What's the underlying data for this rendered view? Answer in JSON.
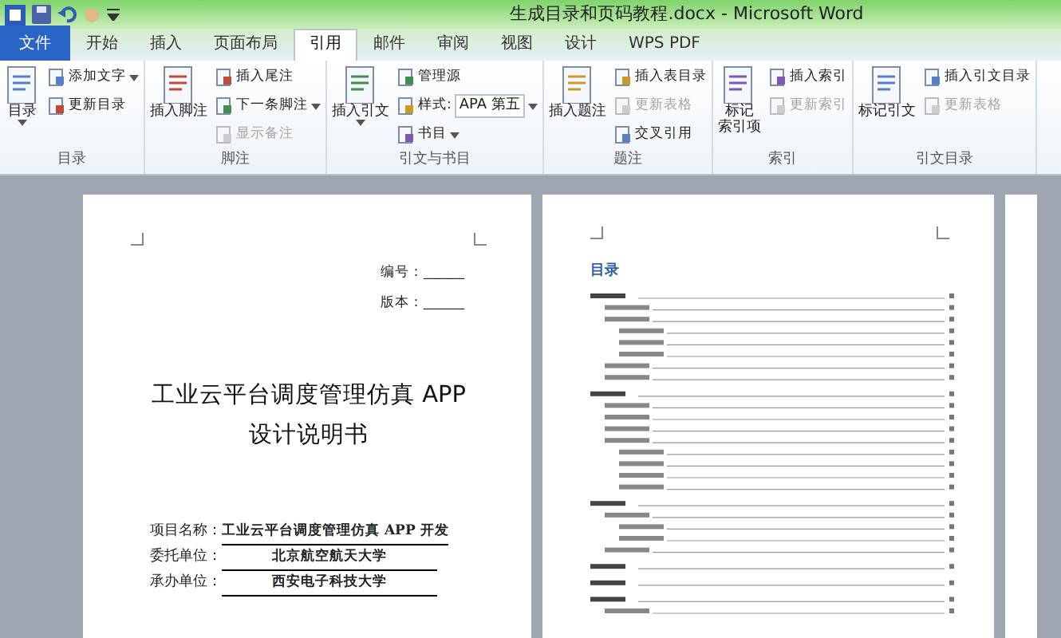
{
  "window": {
    "title": "生成目录和页码教程.docx - Microsoft Word"
  },
  "tabs": [
    {
      "label": "文件",
      "kind": "file",
      "selected": false
    },
    {
      "label": "开始",
      "kind": "tab",
      "selected": false
    },
    {
      "label": "插入",
      "kind": "tab",
      "selected": false
    },
    {
      "label": "页面布局",
      "kind": "tab",
      "selected": false
    },
    {
      "label": "引用",
      "kind": "tab",
      "selected": true
    },
    {
      "label": "邮件",
      "kind": "tab",
      "selected": false
    },
    {
      "label": "审阅",
      "kind": "tab",
      "selected": false
    },
    {
      "label": "视图",
      "kind": "tab",
      "selected": false
    },
    {
      "label": "设计",
      "kind": "tab",
      "selected": false
    },
    {
      "label": "WPS PDF",
      "kind": "tab",
      "selected": false
    }
  ],
  "ribbon_groups": [
    {
      "label": "目录",
      "large": [
        {
          "label": "目录",
          "dropdown": true
        }
      ],
      "small": [
        {
          "label": "添加文字",
          "dropdown": true,
          "disabled": false
        },
        {
          "label": "更新目录",
          "dropdown": false,
          "disabled": false
        }
      ]
    },
    {
      "label": "脚注",
      "large": [
        {
          "label": "插入脚注",
          "dropdown": false
        }
      ],
      "small": [
        {
          "label": "插入尾注",
          "dropdown": false,
          "disabled": false
        },
        {
          "label": "下一条脚注",
          "dropdown": true,
          "disabled": false
        },
        {
          "label": "显示备注",
          "dropdown": false,
          "disabled": true
        }
      ]
    },
    {
      "label": "引文与书目",
      "large": [
        {
          "label": "插入引文",
          "dropdown": true
        }
      ],
      "small": [
        {
          "label": "管理源",
          "dropdown": false,
          "disabled": false
        },
        {
          "label": "样式:",
          "kind": "select",
          "value": "APA 第五",
          "dropdown": true,
          "disabled": false
        },
        {
          "label": "书目",
          "dropdown": true,
          "disabled": false
        }
      ]
    },
    {
      "label": "题注",
      "large": [
        {
          "label": "插入题注",
          "dropdown": false
        }
      ],
      "small": [
        {
          "label": "插入表目录",
          "dropdown": false,
          "disabled": false
        },
        {
          "label": "更新表格",
          "dropdown": false,
          "disabled": true
        },
        {
          "label": "交叉引用",
          "dropdown": false,
          "disabled": false
        }
      ]
    },
    {
      "label": "索引",
      "large": [
        {
          "label": "标记",
          "label_2": "索引项",
          "dropdown": false
        }
      ],
      "small": [
        {
          "label": "插入索引",
          "dropdown": false,
          "disabled": false
        },
        {
          "label": "更新索引",
          "dropdown": false,
          "disabled": true
        }
      ]
    },
    {
      "label": "引文目录",
      "large": [
        {
          "label": "标记引文",
          "dropdown": false
        }
      ],
      "small": [
        {
          "label": "插入引文目录",
          "dropdown": false,
          "disabled": false
        },
        {
          "label": "更新表格",
          "dropdown": false,
          "disabled": true
        }
      ]
    }
  ],
  "cover_page": {
    "meta": [
      {
        "label": "编号：",
        "value": "______"
      },
      {
        "label": "版本：",
        "value": "______"
      }
    ],
    "title_lines": [
      "工业云平台调度管理仿真 APP",
      "设计说明书"
    ],
    "fields": [
      {
        "label": "项目名称：",
        "value": "工业云平台调度管理仿真 APP 开发"
      },
      {
        "label": "委托单位：",
        "value": "北京航空航天大学"
      },
      {
        "label": "承办单位：",
        "value": "西安电子科技大学"
      }
    ]
  },
  "toc_page": {
    "heading": "目录"
  }
}
